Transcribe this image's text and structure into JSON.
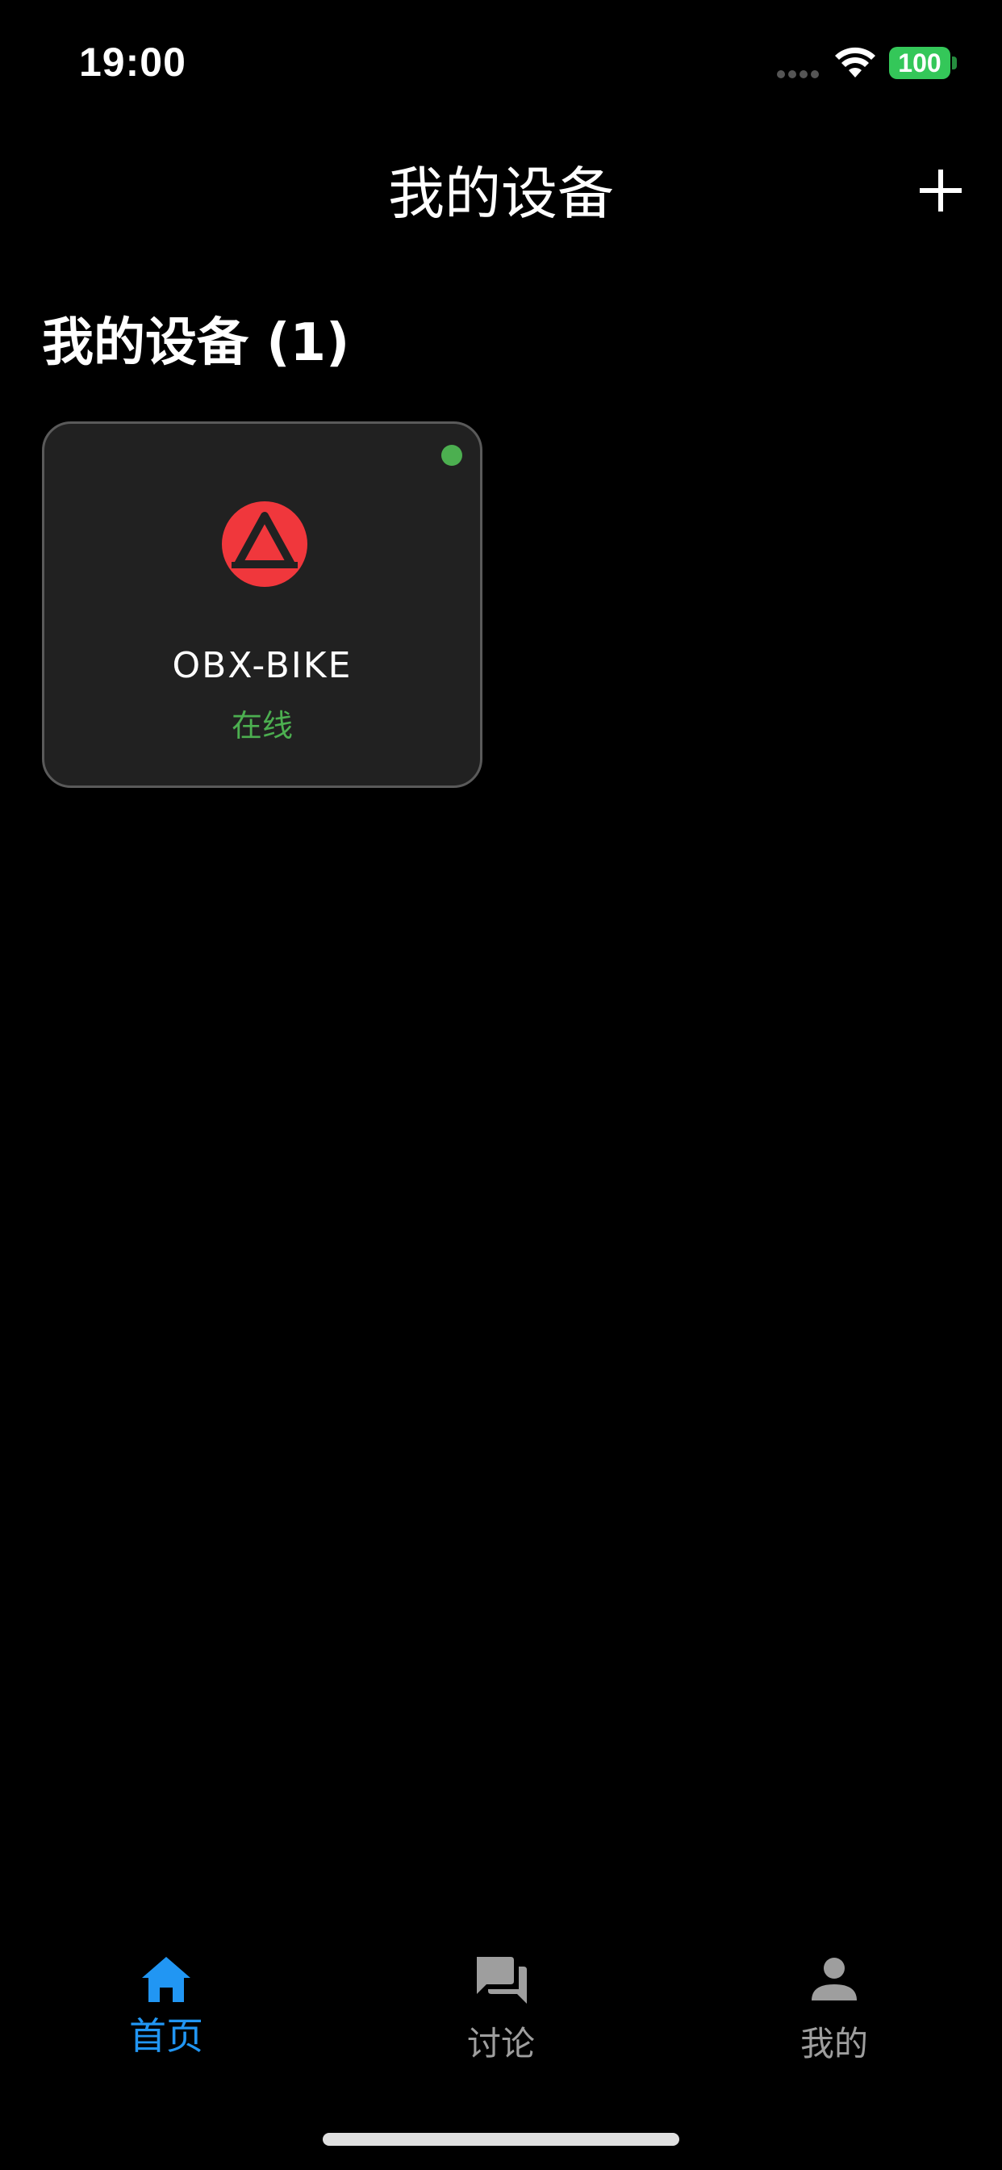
{
  "status_bar": {
    "time": "19:00",
    "battery_level": "100",
    "battery_color": "#34c759",
    "icons": [
      "signal-dots-icon",
      "wifi-icon",
      "battery-icon"
    ]
  },
  "header": {
    "title": "我的设备",
    "add_icon": "plus-icon"
  },
  "section": {
    "title": "我的设备 (1)"
  },
  "devices": [
    {
      "name": "OBX-BIKE",
      "status": "在线",
      "status_color": "#4caf50",
      "logo_icon": "brand-logo-icon",
      "logo_color": "#f0373c"
    }
  ],
  "tab_bar": {
    "active_color": "#2196f3",
    "inactive_color": "#9e9e9e",
    "tabs": [
      {
        "label": "首页",
        "icon": "home-icon",
        "active": true
      },
      {
        "label": "讨论",
        "icon": "chat-bubbles-icon",
        "active": false
      },
      {
        "label": "我的",
        "icon": "person-icon",
        "active": false
      }
    ]
  }
}
